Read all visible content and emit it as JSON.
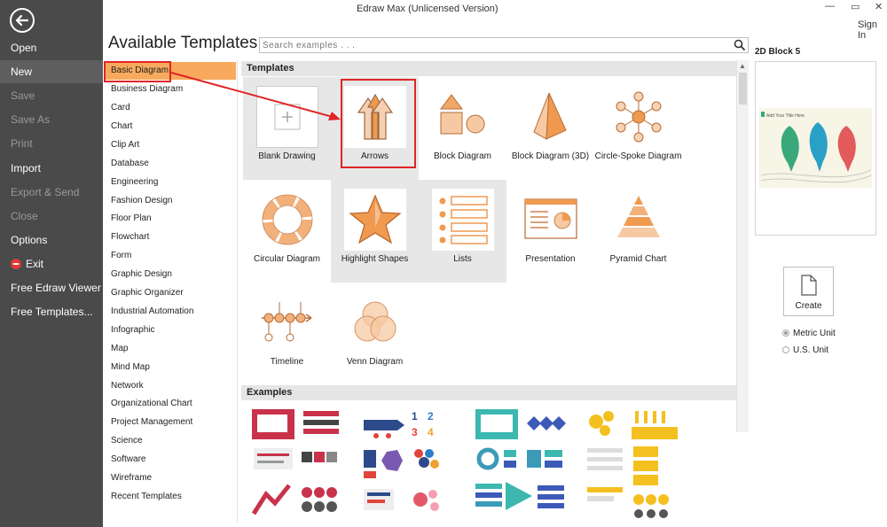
{
  "window": {
    "title": "Edraw Max (Unlicensed Version)",
    "sign_in": "Sign In",
    "controls": [
      "—",
      "▭",
      "✕"
    ]
  },
  "left_menu": {
    "items": [
      {
        "label": "Open",
        "state": "normal"
      },
      {
        "label": "New",
        "state": "active"
      },
      {
        "label": "Save",
        "state": "disabled"
      },
      {
        "label": "Save As",
        "state": "disabled"
      },
      {
        "label": "Print",
        "state": "disabled"
      },
      {
        "label": "Import",
        "state": "normal"
      },
      {
        "label": "Export & Send",
        "state": "disabled"
      },
      {
        "label": "Close",
        "state": "disabled"
      },
      {
        "label": "Options",
        "state": "normal"
      },
      {
        "label": "Exit",
        "state": "normal",
        "icon": "exit-icon"
      },
      {
        "label": "Free Edraw Viewer",
        "state": "normal"
      },
      {
        "label": "Free Templates...",
        "state": "normal"
      }
    ]
  },
  "heading": "Available Templates",
  "search": {
    "placeholder": "Search examples . . . "
  },
  "categories": [
    "Basic Diagram",
    "Business Diagram",
    "Card",
    "Chart",
    "Clip Art",
    "Database",
    "Engineering",
    "Fashion Design",
    "Floor Plan",
    "Flowchart",
    "Form",
    "Graphic Design",
    "Graphic Organizer",
    "Industrial Automation",
    "Infographic",
    "Map",
    "Mind Map",
    "Network",
    "Organizational Chart",
    "Project Management",
    "Science",
    "Software",
    "Wireframe",
    "Recent Templates"
  ],
  "selected_category": "Basic Diagram",
  "templates_header": "Templates",
  "templates": [
    {
      "label": "Blank Drawing",
      "icon": "blank-drawing-icon"
    },
    {
      "label": "Arrows",
      "icon": "arrows-icon"
    },
    {
      "label": "Block Diagram",
      "icon": "block-diagram-icon"
    },
    {
      "label": "Block Diagram (3D)",
      "icon": "pyramid-3d-icon"
    },
    {
      "label": "Circle-Spoke Diagram",
      "icon": "circle-spoke-icon"
    },
    {
      "label": "Circular Diagram",
      "icon": "circular-diagram-icon"
    },
    {
      "label": "Highlight Shapes",
      "icon": "star-icon"
    },
    {
      "label": "Lists",
      "icon": "lists-icon"
    },
    {
      "label": "Presentation",
      "icon": "presentation-icon"
    },
    {
      "label": "Pyramid Chart",
      "icon": "pyramid-chart-icon"
    },
    {
      "label": "Timeline",
      "icon": "timeline-icon"
    },
    {
      "label": "Venn Diagram",
      "icon": "venn-diagram-icon"
    }
  ],
  "examples_header": "Examples",
  "preview": {
    "title": "2D Block 5",
    "thumb_text": "Add Your Title Here"
  },
  "create_button": {
    "label": "Create"
  },
  "units": [
    {
      "label": "Metric Unit",
      "checked": true
    },
    {
      "label": "U.S. Unit",
      "checked": false
    }
  ],
  "colors": {
    "menu_bg": "#4a4a4a",
    "accent_orange": "#f7aa5d",
    "highlight_red": "#e02525",
    "icon_orange": "#f0b27a"
  }
}
